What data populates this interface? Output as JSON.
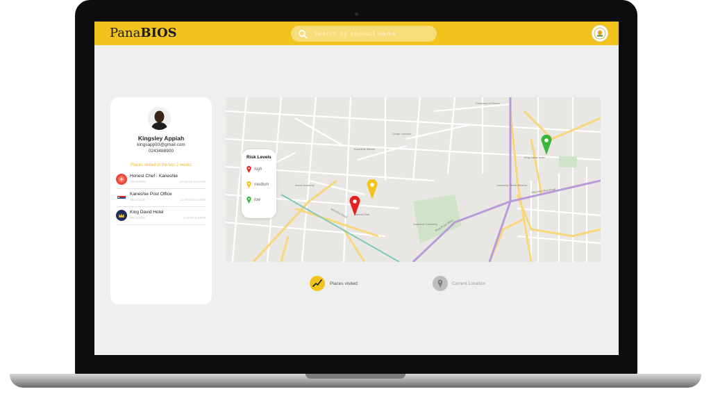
{
  "app": {
    "brand_regular": "Pana",
    "brand_bold": "BIOS"
  },
  "search": {
    "placeholder": "search by contact name",
    "value": ""
  },
  "profile": {
    "name": "Kingsley Appiah",
    "email": "kingsapp93@gmail.com",
    "phone": "0243488900",
    "visited_heading": "Places visited in the last 2 weeks"
  },
  "places": [
    {
      "name": "Honest Chef - Kaneshie",
      "date": "02/04/2020",
      "time": "10:34AM-11:02AM",
      "logo": "Honest Chef",
      "color": "#e8463a"
    },
    {
      "name": "Kaneshie Post Office",
      "date": "06/04/2020",
      "time": "11:34AM-11:54AM",
      "logo": "post-office-icon",
      "color": "#ffffff"
    },
    {
      "name": "King David Hotel",
      "date": "06/04/2020",
      "time": "3:34PM-5:04PM",
      "logo": "crown-icon",
      "color": "#1f2b5c"
    }
  ],
  "legend": {
    "title": "Risk Levels",
    "items": [
      {
        "label": "high",
        "color": "#e3211f"
      },
      {
        "label": "medium",
        "color": "#f2c31c"
      },
      {
        "label": "low",
        "color": "#3bb43a"
      }
    ]
  },
  "map_labels": {
    "accra_academy": "Accra Academy",
    "osu_cemetery": "Kaneshie Cemetery",
    "kingsway": "Winneba Road",
    "ring_road": "Ring Road West",
    "honest_chef": "Honest Chef",
    "king_david": "King David Hotel",
    "kaneshie_market": "Kaneshie Market",
    "abossey": "Abossey Okai Road",
    "university": "University Street Mission",
    "company": "Company of Ghana",
    "zongo": "Zongo Junction"
  },
  "actions": {
    "places_visited": "Places visited",
    "current_location": "Current Location"
  },
  "colors": {
    "accent": "#f2c31c",
    "high": "#e3211f",
    "medium": "#f2c31c",
    "low": "#3bb43a"
  }
}
